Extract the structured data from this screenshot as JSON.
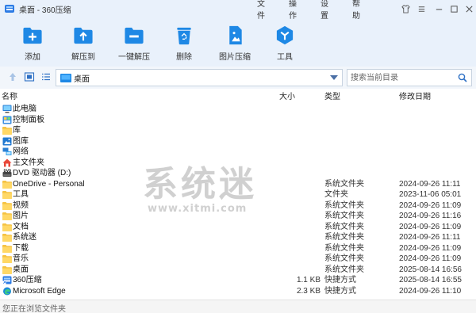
{
  "window": {
    "title": "桌面 - 360压缩"
  },
  "menu": [
    "文件",
    "操作",
    "设置",
    "帮助"
  ],
  "toolbar": {
    "add": "添加",
    "extract_to": "解压到",
    "one_click_extract": "一键解压",
    "delete": "删除",
    "image_compress": "图片压缩",
    "tools": "工具"
  },
  "address": {
    "location": "桌面"
  },
  "search": {
    "placeholder": "搜索当前目录"
  },
  "columns": {
    "name": "名称",
    "size": "大小",
    "type": "类型",
    "modified": "修改日期"
  },
  "files": [
    {
      "name": "此电脑",
      "size": "",
      "type": "",
      "modified": "",
      "icon": "computer-icon"
    },
    {
      "name": "控制面板",
      "size": "",
      "type": "",
      "modified": "",
      "icon": "control-panel-icon"
    },
    {
      "name": "库",
      "size": "",
      "type": "",
      "modified": "",
      "icon": "folder-icon"
    },
    {
      "name": "图库",
      "size": "",
      "type": "",
      "modified": "",
      "icon": "gallery-icon"
    },
    {
      "name": "网络",
      "size": "",
      "type": "",
      "modified": "",
      "icon": "network-icon"
    },
    {
      "name": "主文件夹",
      "size": "",
      "type": "",
      "modified": "",
      "icon": "home-icon"
    },
    {
      "name": "DVD 驱动器 (D:)",
      "size": "",
      "type": "",
      "modified": "",
      "icon": "dvd-drive-icon"
    },
    {
      "name": "OneDrive - Personal",
      "size": "",
      "type": "系统文件夹",
      "modified": "2024-09-26 11:11",
      "icon": "folder-icon"
    },
    {
      "name": "工具",
      "size": "",
      "type": "文件夹",
      "modified": "2023-11-06 05:01",
      "icon": "folder-icon"
    },
    {
      "name": "视频",
      "size": "",
      "type": "系统文件夹",
      "modified": "2024-09-26 11:09",
      "icon": "folder-icon"
    },
    {
      "name": "图片",
      "size": "",
      "type": "系统文件夹",
      "modified": "2024-09-26 11:16",
      "icon": "folder-icon"
    },
    {
      "name": "文档",
      "size": "",
      "type": "系统文件夹",
      "modified": "2024-09-26 11:09",
      "icon": "folder-icon"
    },
    {
      "name": "系统迷",
      "size": "",
      "type": "系统文件夹",
      "modified": "2024-09-26 11:11",
      "icon": "folder-icon"
    },
    {
      "name": "下载",
      "size": "",
      "type": "系统文件夹",
      "modified": "2024-09-26 11:09",
      "icon": "folder-icon"
    },
    {
      "name": "音乐",
      "size": "",
      "type": "系统文件夹",
      "modified": "2024-09-26 11:09",
      "icon": "folder-icon"
    },
    {
      "name": "桌面",
      "size": "",
      "type": "系统文件夹",
      "modified": "2025-08-14 16:56",
      "icon": "folder-icon"
    },
    {
      "name": "360压缩",
      "size": "1.1 KB",
      "type": "快捷方式",
      "modified": "2025-08-14 16:55",
      "icon": "shortcut-360-icon"
    },
    {
      "name": "Microsoft Edge",
      "size": "2.3 KB",
      "type": "快捷方式",
      "modified": "2024-09-26 11:10",
      "icon": "edge-icon"
    }
  ],
  "watermark": {
    "main": "系统迷",
    "sub": "www.xitmi.com"
  },
  "status": {
    "text": "您正在浏览文件夹"
  },
  "colors": {
    "accent": "#1e88e5",
    "folder": "#f5c242",
    "toolbar_bg": "#e9f1fb"
  }
}
